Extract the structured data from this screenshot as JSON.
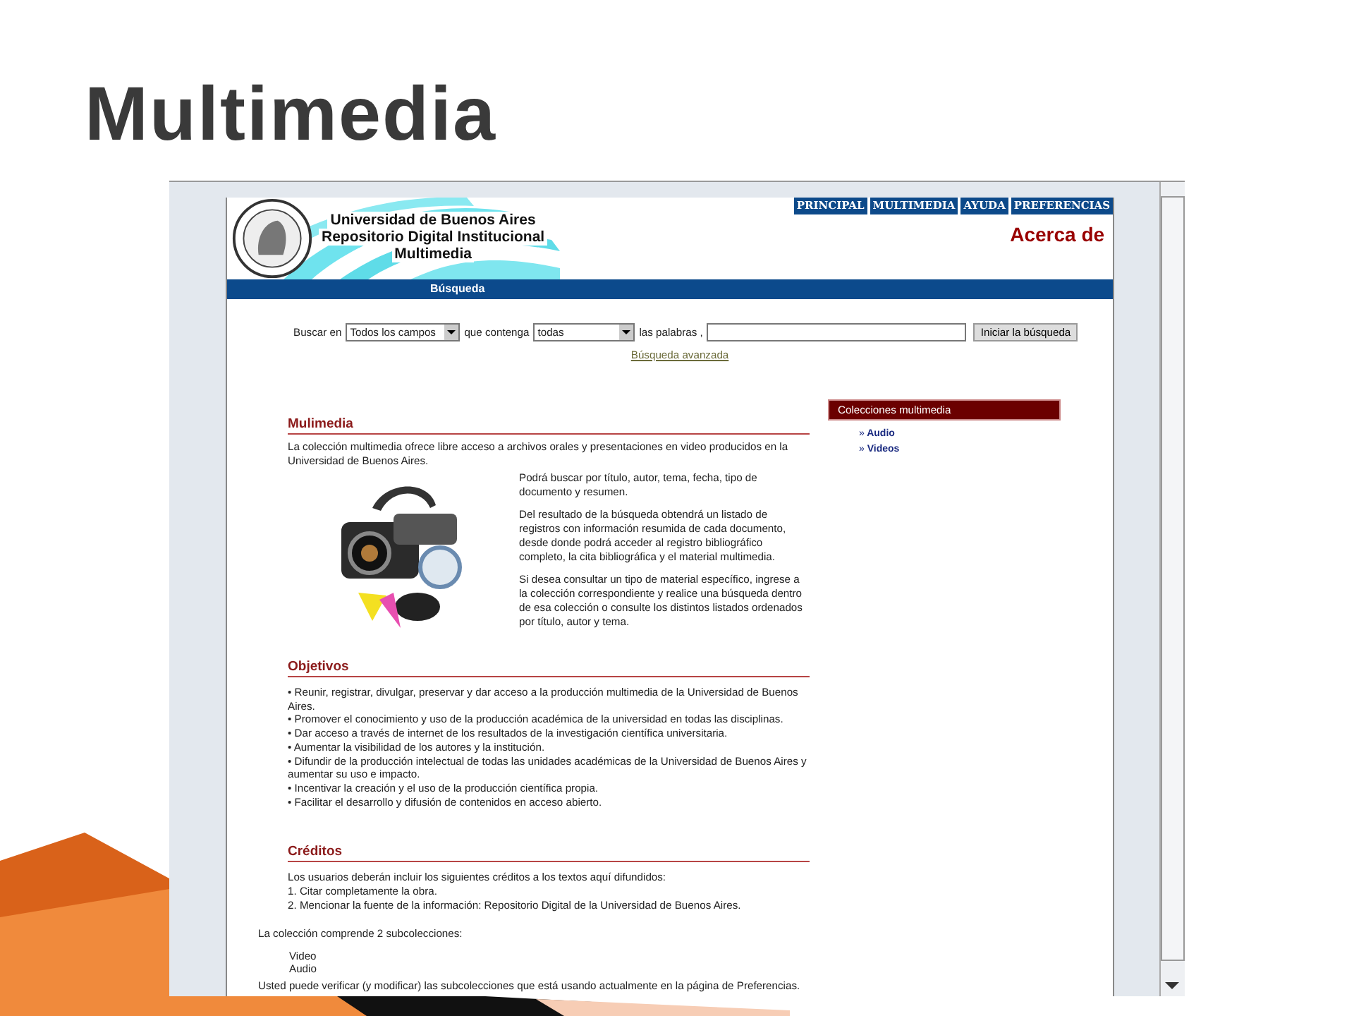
{
  "slide_title": "Multimedia",
  "header": {
    "title_lines": [
      "Universidad de Buenos Aires",
      "Repositorio Digital Institucional",
      "Multimedia"
    ],
    "nav": [
      {
        "label": "PRINCIPAL"
      },
      {
        "label": "MULTIMEDIA"
      },
      {
        "label": "AYUDA"
      },
      {
        "label": "PREFERENCIAS"
      }
    ],
    "page_title": "Acerca de"
  },
  "section_bar": "Búsqueda",
  "search": {
    "label_in": "Buscar en",
    "field_select": "Todos los campos",
    "label_contains": "que contenga",
    "mode_select": "todas",
    "label_words": "las palabras ,",
    "button": "Iniciar la búsqueda",
    "advanced_link": "Búsqueda avanzada"
  },
  "intro": {
    "heading": "Mulimedia",
    "paragraph": "La colección multimedia ofrece libre acceso a archivos orales y presentaciones en video producidos en la Universidad de Buenos Aires.",
    "side_paragraphs": [
      "Podrá buscar por título, autor, tema, fecha, tipo de documento y resumen.",
      "Del resultado de la búsqueda obtendrá un listado de registros con información resumida de cada documento, desde donde podrá acceder al registro bibliográfico completo, la cita bibliográfica y el material multimedia.",
      "Si desea consultar un tipo de material específico, ingrese a la colección correspondiente y realice una búsqueda dentro de esa colección o consulte los distintos listados ordenados por título, autor y tema."
    ]
  },
  "objectives": {
    "heading": "Objetivos",
    "items": [
      "• Reunir, registrar, divulgar, preservar y dar acceso a la producción multimedia de la Universidad de Buenos Aires.",
      "• Promover el conocimiento y uso de la producción académica de la universidad en todas las disciplinas.",
      "• Dar acceso a través de internet de los resultados de la investigación científica universitaria.",
      "• Aumentar la visibilidad de los autores y la institución.",
      "• Difundir de la producción intelectual de todas las unidades académicas de la Universidad de Buenos Aires y aumentar su uso e impacto.",
      "• Incentivar la creación y el uso de la producción científica propia.",
      "• Facilitar el desarrollo y difusión de contenidos en acceso abierto."
    ]
  },
  "credits": {
    "heading": "Créditos",
    "lines": [
      "Los usuarios deberán incluir los siguientes créditos a los textos aquí difundidos:",
      "1. Citar completamente la obra.",
      "2. Mencionar la fuente de la información: Repositorio Digital de la Universidad de Buenos Aires."
    ]
  },
  "sidebar": {
    "title": "Colecciones multimedia",
    "links": [
      {
        "marker": "»",
        "label": "Audio"
      },
      {
        "marker": "»",
        "label": "Videos"
      }
    ]
  },
  "footer": {
    "summary": "La colección comprende 2 subcolecciones:",
    "subcollections": [
      "Video",
      "Audio"
    ],
    "note": "Usted puede verificar (y modificar) las subcolecciones que está usando actualmente en la página de Preferencias."
  }
}
